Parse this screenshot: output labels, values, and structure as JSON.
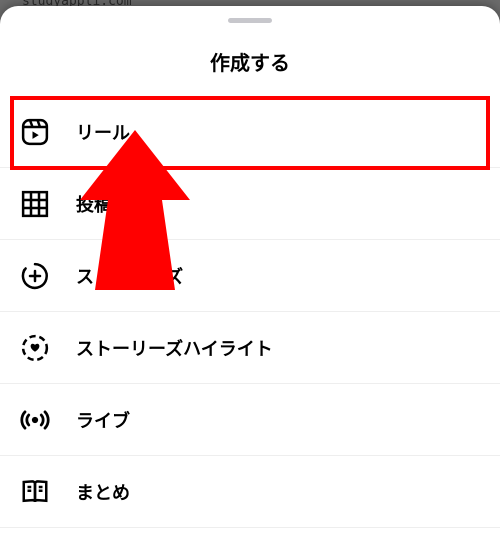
{
  "backgroundUrl": "studyappli.com",
  "sheet": {
    "title": "作成する",
    "items": [
      {
        "label": "リール",
        "icon": "reel"
      },
      {
        "label": "投稿",
        "icon": "grid"
      },
      {
        "label": "ストーリーズ",
        "icon": "story"
      },
      {
        "label": "ストーリーズハイライト",
        "icon": "highlight"
      },
      {
        "label": "ライブ",
        "icon": "live"
      },
      {
        "label": "まとめ",
        "icon": "guide"
      }
    ]
  },
  "annotation": {
    "highlightedIndex": 0,
    "arrowColor": "#ff0000"
  }
}
